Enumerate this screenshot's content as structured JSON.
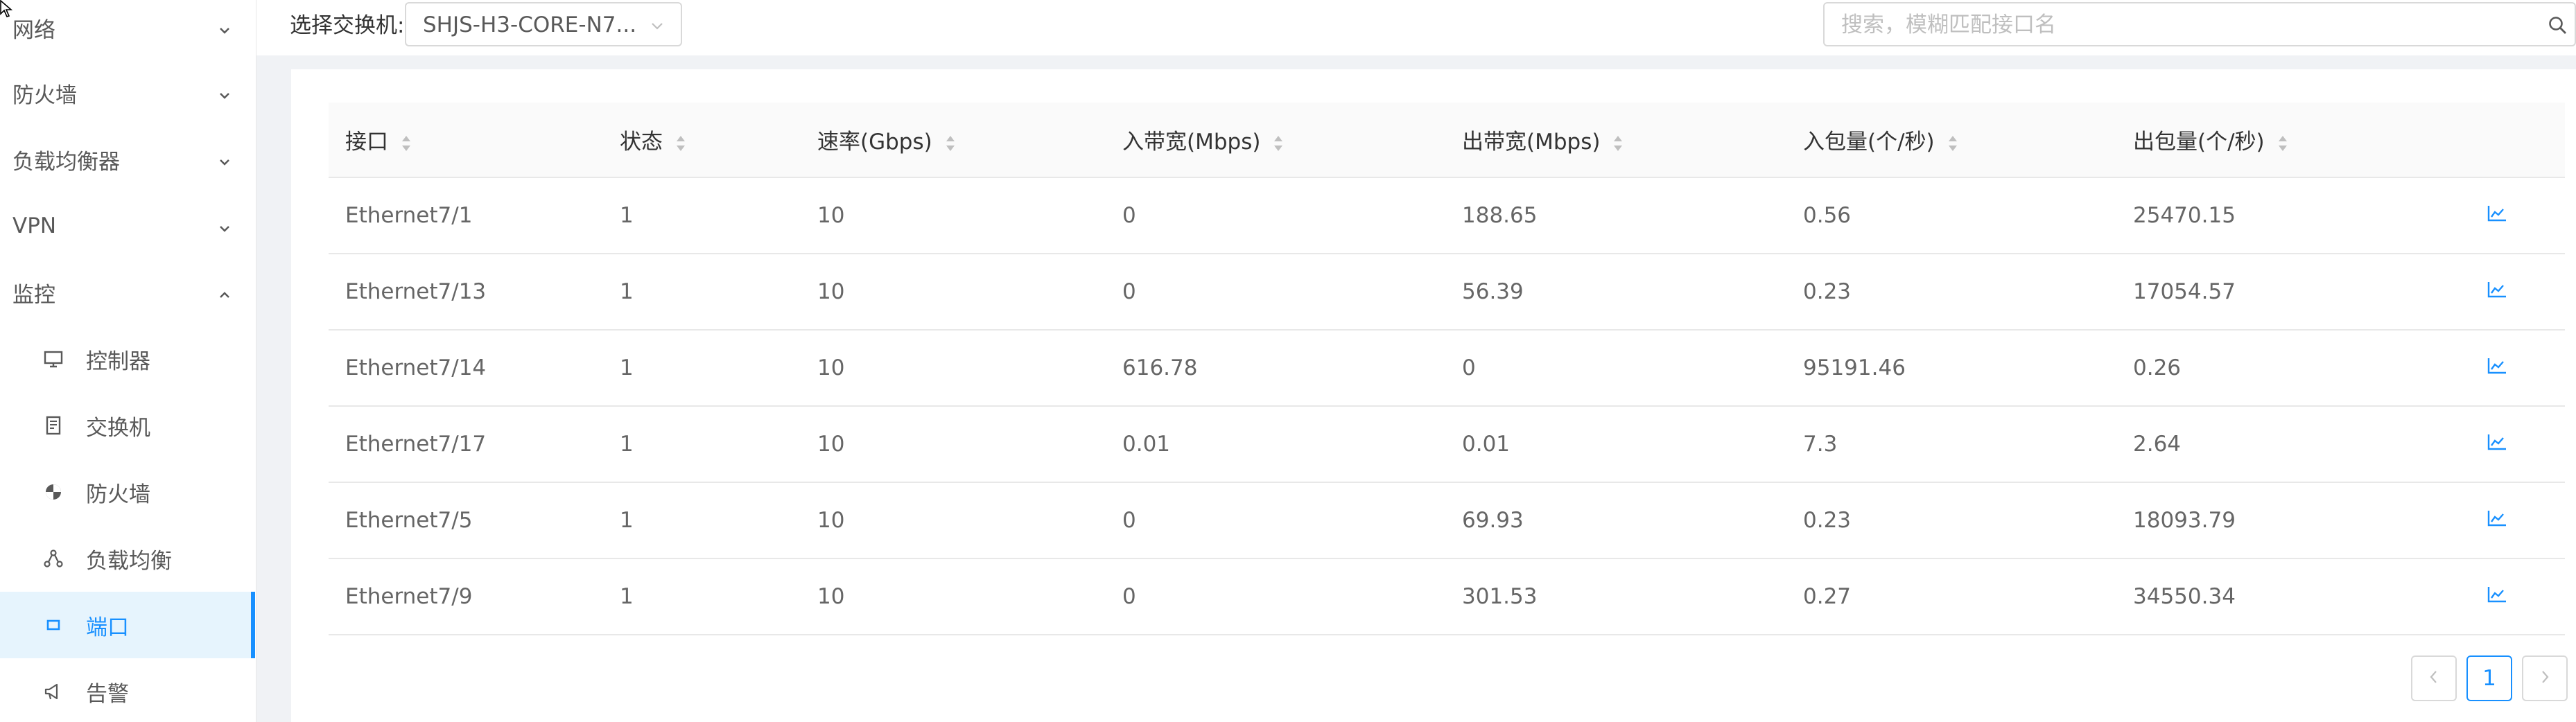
{
  "sidebar": {
    "menu": [
      {
        "label": "网络",
        "expanded": false
      },
      {
        "label": "防火墙",
        "expanded": false
      },
      {
        "label": "负载均衡器",
        "expanded": false
      },
      {
        "label": "VPN",
        "expanded": false
      },
      {
        "label": "监控",
        "expanded": true
      }
    ],
    "sub_items": [
      {
        "label": "控制器",
        "icon": "monitor-icon",
        "active": false
      },
      {
        "label": "交换机",
        "icon": "switch-icon",
        "active": false
      },
      {
        "label": "防火墙",
        "icon": "shield-icon",
        "active": false
      },
      {
        "label": "负载均衡",
        "icon": "load-balance-icon",
        "active": false
      },
      {
        "label": "端口",
        "icon": "port-icon",
        "active": true
      },
      {
        "label": "告警",
        "icon": "alarm-icon",
        "active": false
      }
    ]
  },
  "toolbar": {
    "switch_label": "选择交换机:",
    "switch_value": "SHJS-H3-CORE-N7...",
    "search_placeholder": "搜索，模糊匹配接口名"
  },
  "table": {
    "columns": [
      "接口",
      "状态",
      "速率(Gbps)",
      "入带宽(Mbps)",
      "出带宽(Mbps)",
      "入包量(个/秒)",
      "出包量(个/秒)"
    ],
    "rows": [
      [
        "Ethernet7/1",
        "1",
        "10",
        "0",
        "188.65",
        "0.56",
        "25470.15"
      ],
      [
        "Ethernet7/13",
        "1",
        "10",
        "0",
        "56.39",
        "0.23",
        "17054.57"
      ],
      [
        "Ethernet7/14",
        "1",
        "10",
        "616.78",
        "0",
        "95191.46",
        "0.26"
      ],
      [
        "Ethernet7/17",
        "1",
        "10",
        "0.01",
        "0.01",
        "7.3",
        "2.64"
      ],
      [
        "Ethernet7/5",
        "1",
        "10",
        "0",
        "69.93",
        "0.23",
        "18093.79"
      ],
      [
        "Ethernet7/9",
        "1",
        "10",
        "0",
        "301.53",
        "0.27",
        "34550.34"
      ]
    ]
  },
  "pagination": {
    "current": "1"
  },
  "colors": {
    "accent": "#1890ff",
    "active_bg": "#e6f4fd",
    "content_bg": "#f0f2f5"
  }
}
